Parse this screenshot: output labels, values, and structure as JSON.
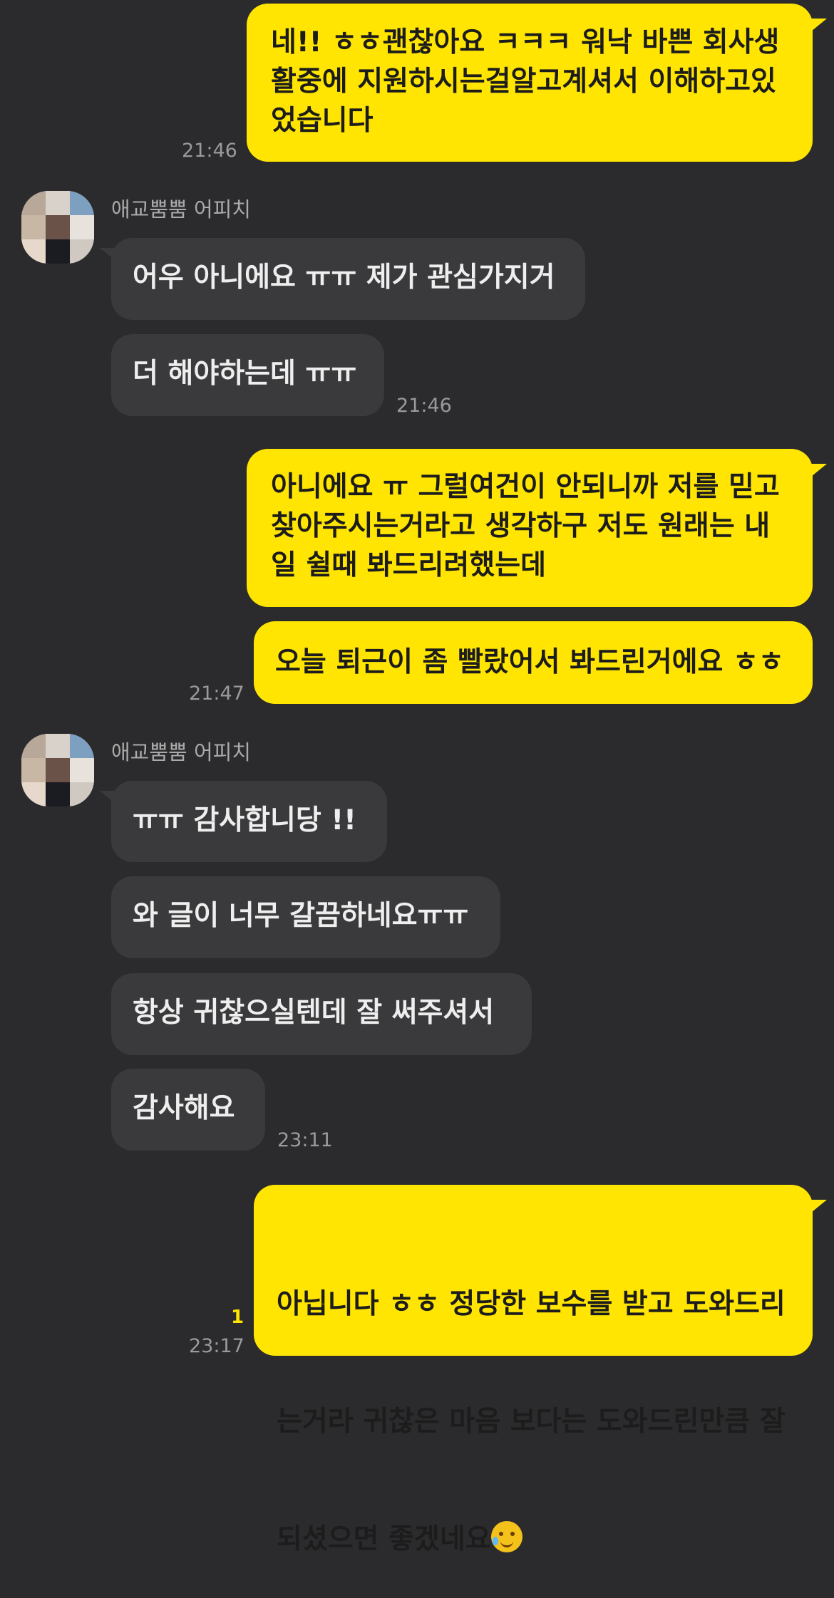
{
  "contact": {
    "name": "애교뿜뿜 어피치"
  },
  "messages": {
    "m1": "네!! ㅎㅎ괜찮아요 ㅋㅋㅋ 워낙 바쁜 회사생\n활중에 지원하시는걸알고계셔서 이해하고있\n었습니다",
    "m1_time": "21:46",
    "m2": "어우 아니에요 ㅠㅠ 제가 관심가지거",
    "m3": "더 해야하는데 ㅠㅠ",
    "m3_time": "21:46",
    "m4": "아니에요 ㅠ 그럴여건이 안되니까 저를 믿고\n찾아주시는거라고 생각하구 저도 원래는 내\n일 쉴때 봐드리려했는데",
    "m5": "오늘 퇴근이 좀 빨랐어서 봐드린거에요 ㅎㅎ",
    "m5_time": "21:47",
    "m6": "ㅠㅠ 감사합니당 !!",
    "m7": "와 글이 너무 갈끔하네요ㅠㅠ",
    "m8": "항상 귀찮으실텐데 잘 써주셔서",
    "m9": "감사해요",
    "m9_time": "23:11",
    "m10_line1": "아닙니다 ㅎㅎ 정당한 보수를 받고 도와드리",
    "m10_line2": "는거라 귀찮은 마음 보다는 도와드린만큼 잘",
    "m10_line3": "되셨으면 좋겠네요",
    "m10_emoji": "face-holding-back-tears",
    "m10_time": "23:17",
    "m10_unread": "1"
  },
  "colors": {
    "background": "#2b2b2d",
    "my_bubble": "#ffe501",
    "their_bubble": "#3a3a3c"
  }
}
